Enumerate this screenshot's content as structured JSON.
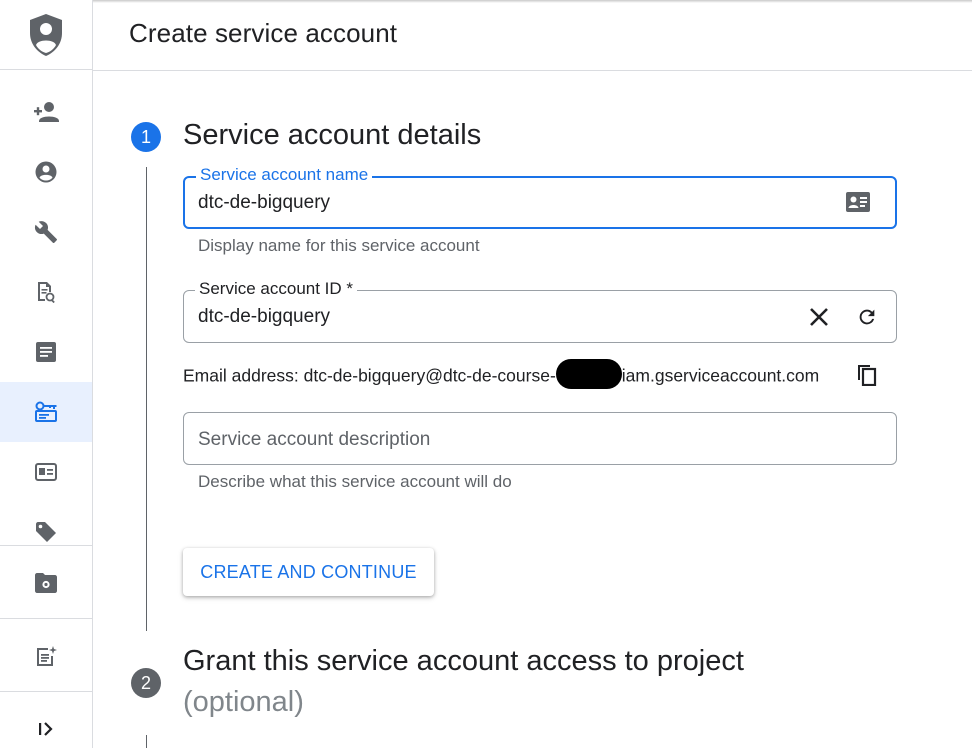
{
  "header": {
    "title": "Create service account"
  },
  "sidebar": {
    "items": [
      {
        "name": "add-person-icon"
      },
      {
        "name": "account-circle-icon"
      },
      {
        "name": "wrench-icon"
      },
      {
        "name": "policy-doc-icon"
      },
      {
        "name": "article-icon"
      },
      {
        "name": "service-accounts-icon",
        "active": true
      },
      {
        "name": "id-card-icon"
      },
      {
        "name": "tag-icon"
      },
      {
        "name": "folder-settings-icon"
      },
      {
        "name": "release-notes-icon"
      },
      {
        "name": "expand-menu-icon"
      }
    ]
  },
  "step1": {
    "number": "1",
    "title": "Service account details",
    "name_field": {
      "label": "Service account name",
      "value": "dtc-de-bigquery",
      "hint": "Display name for this service account"
    },
    "id_field": {
      "label": "Service account ID *",
      "value": "dtc-de-bigquery"
    },
    "email": {
      "prefix": "Email address: dtc-de-bigquery@dtc-de-course-",
      "suffix": "iam.gserviceaccount.com"
    },
    "description_field": {
      "placeholder": "Service account description",
      "hint": "Describe what this service account will do"
    },
    "create_button": "CREATE AND CONTINUE"
  },
  "step2": {
    "number": "2",
    "title": "Grant this service account access to project",
    "subtitle": "(optional)"
  },
  "colors": {
    "accent": "#1a73e8",
    "step_inactive": "#5f6368",
    "active_nav_bg": "#e8f0fe"
  }
}
